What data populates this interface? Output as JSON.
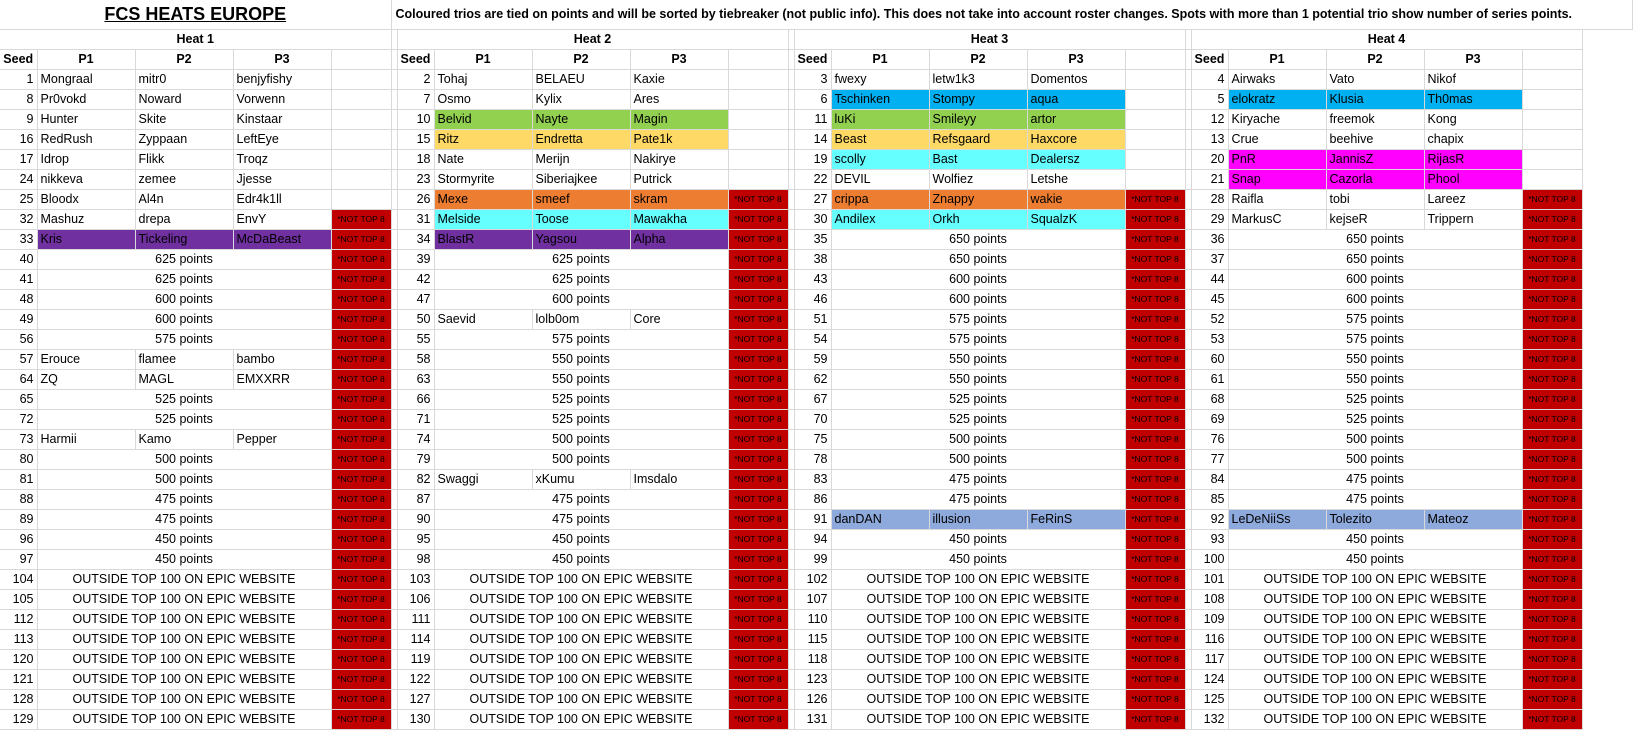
{
  "title": "FCS HEATS EUROPE",
  "note": "Coloured trios are tied on points and will be sorted by tiebreaker (not public info). This does not take into account roster changes. Spots with more than 1 potential trio show number of series points.",
  "col_headers": {
    "seed": "Seed",
    "p1": "P1",
    "p2": "P2",
    "p3": "P3"
  },
  "not_top8": "*NOT TOP 8",
  "colors": {
    "purple": "#7030a0",
    "green": "#92d050",
    "yellow": "#ffd966",
    "orange": "#ed7d31",
    "cyan": "#66ffff",
    "blue": "#00b0f0",
    "magenta": "#ff00ff",
    "periwinkle": "#8ea9db",
    "red": "#c00000"
  },
  "heats": [
    {
      "name": "Heat 1",
      "rows": [
        {
          "seed": "1",
          "p": [
            "Mongraal",
            "mitr0",
            "benjyfishy"
          ]
        },
        {
          "seed": "8",
          "p": [
            "Pr0vokd",
            "Noward",
            "Vorwenn"
          ]
        },
        {
          "seed": "9",
          "p": [
            "Hunter",
            "Skite",
            "Kinstaar"
          ]
        },
        {
          "seed": "16",
          "p": [
            "RedRush",
            "Zyppaan",
            "LeftEye"
          ]
        },
        {
          "seed": "17",
          "p": [
            "Idrop",
            "Flikk",
            "Troqz"
          ]
        },
        {
          "seed": "24",
          "p": [
            "nikkeva",
            "zemee",
            "Jjesse"
          ]
        },
        {
          "seed": "25",
          "p": [
            "Bloodx",
            "Al4n",
            "Edr4k1ll"
          ]
        },
        {
          "seed": "32",
          "p": [
            "Mashuz",
            "drepa",
            "EnvY"
          ],
          "nt": true
        },
        {
          "seed": "33",
          "p": [
            "Kris",
            "Tickeling",
            "McDaBeast"
          ],
          "color": "purple",
          "nt": true
        },
        {
          "seed": "40",
          "pts": "625 points",
          "nt": true
        },
        {
          "seed": "41",
          "pts": "625 points",
          "nt": true
        },
        {
          "seed": "48",
          "pts": "600 points",
          "nt": true
        },
        {
          "seed": "49",
          "pts": "600 points",
          "nt": true
        },
        {
          "seed": "56",
          "pts": "575 points",
          "nt": true
        },
        {
          "seed": "57",
          "p": [
            "Erouce",
            "flamee",
            "bambo"
          ],
          "nt": true
        },
        {
          "seed": "64",
          "p": [
            "ZQ",
            "MAGL",
            "EMXXRR"
          ],
          "nt": true
        },
        {
          "seed": "65",
          "pts": "525 points",
          "nt": true
        },
        {
          "seed": "72",
          "pts": "525 points",
          "nt": true
        },
        {
          "seed": "73",
          "p": [
            "Harmii",
            "Kamo",
            "Pepper"
          ],
          "nt": true
        },
        {
          "seed": "80",
          "pts": "500 points",
          "nt": true
        },
        {
          "seed": "81",
          "pts": "500 points",
          "nt": true
        },
        {
          "seed": "88",
          "pts": "475 points",
          "nt": true
        },
        {
          "seed": "89",
          "pts": "475 points",
          "nt": true
        },
        {
          "seed": "96",
          "pts": "450 points",
          "nt": true
        },
        {
          "seed": "97",
          "pts": "450 points",
          "nt": true
        },
        {
          "seed": "104",
          "pts": "OUTSIDE TOP 100 ON EPIC WEBSITE",
          "nt": true
        },
        {
          "seed": "105",
          "pts": "OUTSIDE TOP 100 ON EPIC WEBSITE",
          "nt": true
        },
        {
          "seed": "112",
          "pts": "OUTSIDE TOP 100 ON EPIC WEBSITE",
          "nt": true
        },
        {
          "seed": "113",
          "pts": "OUTSIDE TOP 100 ON EPIC WEBSITE",
          "nt": true
        },
        {
          "seed": "120",
          "pts": "OUTSIDE TOP 100 ON EPIC WEBSITE",
          "nt": true
        },
        {
          "seed": "121",
          "pts": "OUTSIDE TOP 100 ON EPIC WEBSITE",
          "nt": true
        },
        {
          "seed": "128",
          "pts": "OUTSIDE TOP 100 ON EPIC WEBSITE",
          "nt": true
        },
        {
          "seed": "129",
          "pts": "OUTSIDE TOP 100 ON EPIC WEBSITE",
          "nt": true
        }
      ]
    },
    {
      "name": "Heat 2",
      "rows": [
        {
          "seed": "2",
          "p": [
            "Tohaj",
            "BELAEU",
            "Kaxie"
          ]
        },
        {
          "seed": "7",
          "p": [
            "Osmo",
            "Kylix",
            "Ares"
          ]
        },
        {
          "seed": "10",
          "p": [
            "Belvid",
            "Nayte",
            "Magin"
          ],
          "color": "green"
        },
        {
          "seed": "15",
          "p": [
            "Ritz",
            "Endretta",
            "Pate1k"
          ],
          "color": "yellow"
        },
        {
          "seed": "18",
          "p": [
            "Nate",
            "Merijn",
            "Nakirye"
          ]
        },
        {
          "seed": "23",
          "p": [
            "Stormyrite",
            "Siberiajkee",
            "Putrick"
          ]
        },
        {
          "seed": "26",
          "p": [
            "Mexe",
            "smeef",
            "skram"
          ],
          "color": "orange",
          "nt": true
        },
        {
          "seed": "31",
          "p": [
            "Melside",
            "Toose",
            "Mawakha"
          ],
          "color": "cyan",
          "nt": true
        },
        {
          "seed": "34",
          "p": [
            "BlastR",
            "Yagsou",
            "Alpha"
          ],
          "color": "purple",
          "nt": true
        },
        {
          "seed": "39",
          "pts": "625 points",
          "nt": true
        },
        {
          "seed": "42",
          "pts": "625 points",
          "nt": true
        },
        {
          "seed": "47",
          "pts": "600 points",
          "nt": true
        },
        {
          "seed": "50",
          "p": [
            "Saevid",
            "lolb0om",
            "Core"
          ],
          "nt": true
        },
        {
          "seed": "55",
          "pts": "575 points",
          "nt": true
        },
        {
          "seed": "58",
          "pts": "550 points",
          "nt": true
        },
        {
          "seed": "63",
          "pts": "550 points",
          "nt": true
        },
        {
          "seed": "66",
          "pts": "525 points",
          "nt": true
        },
        {
          "seed": "71",
          "pts": "525 points",
          "nt": true
        },
        {
          "seed": "74",
          "pts": "500 points",
          "nt": true
        },
        {
          "seed": "79",
          "pts": "500 points",
          "nt": true
        },
        {
          "seed": "82",
          "p": [
            "Swaggi",
            "xKumu",
            "Imsdalo"
          ],
          "nt": true
        },
        {
          "seed": "87",
          "pts": "475 points",
          "nt": true
        },
        {
          "seed": "90",
          "pts": "475 points",
          "nt": true
        },
        {
          "seed": "95",
          "pts": "450 points",
          "nt": true
        },
        {
          "seed": "98",
          "pts": "450 points",
          "nt": true
        },
        {
          "seed": "103",
          "pts": "OUTSIDE TOP 100 ON EPIC WEBSITE",
          "nt": true
        },
        {
          "seed": "106",
          "pts": "OUTSIDE TOP 100 ON EPIC WEBSITE",
          "nt": true
        },
        {
          "seed": "111",
          "pts": "OUTSIDE TOP 100 ON EPIC WEBSITE",
          "nt": true
        },
        {
          "seed": "114",
          "pts": "OUTSIDE TOP 100 ON EPIC WEBSITE",
          "nt": true
        },
        {
          "seed": "119",
          "pts": "OUTSIDE TOP 100 ON EPIC WEBSITE",
          "nt": true
        },
        {
          "seed": "122",
          "pts": "OUTSIDE TOP 100 ON EPIC WEBSITE",
          "nt": true
        },
        {
          "seed": "127",
          "pts": "OUTSIDE TOP 100 ON EPIC WEBSITE",
          "nt": true
        },
        {
          "seed": "130",
          "pts": "OUTSIDE TOP 100 ON EPIC WEBSITE",
          "nt": true
        }
      ]
    },
    {
      "name": "Heat 3",
      "rows": [
        {
          "seed": "3",
          "p": [
            "fwexy",
            "letw1k3",
            "Domentos"
          ]
        },
        {
          "seed": "6",
          "p": [
            "Tschinken",
            "Stompy",
            "aqua"
          ],
          "color": "blue"
        },
        {
          "seed": "11",
          "p": [
            "luKi",
            "Smileyy",
            "artor"
          ],
          "color": "green"
        },
        {
          "seed": "14",
          "p": [
            "Beast",
            "Refsgaard",
            "Haxcore"
          ],
          "color": "yellow"
        },
        {
          "seed": "19",
          "p": [
            "scolly",
            "Bast",
            "Dealersz"
          ],
          "color": "cyan"
        },
        {
          "seed": "22",
          "p": [
            "DEVIL",
            "Wolfiez",
            "Letshe"
          ]
        },
        {
          "seed": "27",
          "p": [
            "crippa",
            "Znappy",
            "wakie"
          ],
          "color": "orange",
          "nt": true
        },
        {
          "seed": "30",
          "p": [
            "Andilex",
            "Orkh",
            "SqualzK"
          ],
          "color": "cyan",
          "nt": true
        },
        {
          "seed": "35",
          "pts": "650 points",
          "nt": true
        },
        {
          "seed": "38",
          "pts": "650 points",
          "nt": true
        },
        {
          "seed": "43",
          "pts": "600 points",
          "nt": true
        },
        {
          "seed": "46",
          "pts": "600 points",
          "nt": true
        },
        {
          "seed": "51",
          "pts": "575 points",
          "nt": true
        },
        {
          "seed": "54",
          "pts": "575 points",
          "nt": true
        },
        {
          "seed": "59",
          "pts": "550 points",
          "nt": true
        },
        {
          "seed": "62",
          "pts": "550 points",
          "nt": true
        },
        {
          "seed": "67",
          "pts": "525 points",
          "nt": true
        },
        {
          "seed": "70",
          "pts": "525 points",
          "nt": true
        },
        {
          "seed": "75",
          "pts": "500 points",
          "nt": true
        },
        {
          "seed": "78",
          "pts": "500 points",
          "nt": true
        },
        {
          "seed": "83",
          "pts": "475 points",
          "nt": true
        },
        {
          "seed": "86",
          "pts": "475 points",
          "nt": true
        },
        {
          "seed": "91",
          "p": [
            "danDAN",
            "illusion",
            "FeRinS"
          ],
          "color": "periwinkle",
          "nt": true
        },
        {
          "seed": "94",
          "pts": "450 points",
          "nt": true
        },
        {
          "seed": "99",
          "pts": "450 points",
          "nt": true
        },
        {
          "seed": "102",
          "pts": "OUTSIDE TOP 100 ON EPIC WEBSITE",
          "nt": true
        },
        {
          "seed": "107",
          "pts": "OUTSIDE TOP 100 ON EPIC WEBSITE",
          "nt": true
        },
        {
          "seed": "110",
          "pts": "OUTSIDE TOP 100 ON EPIC WEBSITE",
          "nt": true
        },
        {
          "seed": "115",
          "pts": "OUTSIDE TOP 100 ON EPIC WEBSITE",
          "nt": true
        },
        {
          "seed": "118",
          "pts": "OUTSIDE TOP 100 ON EPIC WEBSITE",
          "nt": true
        },
        {
          "seed": "123",
          "pts": "OUTSIDE TOP 100 ON EPIC WEBSITE",
          "nt": true
        },
        {
          "seed": "126",
          "pts": "OUTSIDE TOP 100 ON EPIC WEBSITE",
          "nt": true
        },
        {
          "seed": "131",
          "pts": "OUTSIDE TOP 100 ON EPIC WEBSITE",
          "nt": true
        }
      ]
    },
    {
      "name": "Heat 4",
      "rows": [
        {
          "seed": "4",
          "p": [
            "Airwaks",
            "Vato",
            "Nikof"
          ]
        },
        {
          "seed": "5",
          "p": [
            "elokratz",
            "Klusia",
            "Th0mas"
          ],
          "color": "blue"
        },
        {
          "seed": "12",
          "p": [
            "Kiryache",
            "freemok",
            "Kong"
          ]
        },
        {
          "seed": "13",
          "p": [
            "Crue",
            "beehive",
            "chapix"
          ]
        },
        {
          "seed": "20",
          "p": [
            "PnR",
            "JannisZ",
            "RijasR"
          ],
          "color": "magenta"
        },
        {
          "seed": "21",
          "p": [
            "Snap",
            "Cazorla",
            "Phool"
          ],
          "color": "magenta"
        },
        {
          "seed": "28",
          "p": [
            "Raifla",
            "tobi",
            "Lareez"
          ],
          "nt": true
        },
        {
          "seed": "29",
          "p": [
            "MarkusC",
            "kejseR",
            "Trippern"
          ],
          "nt": true
        },
        {
          "seed": "36",
          "pts": "650 points",
          "nt": true
        },
        {
          "seed": "37",
          "pts": "650 points",
          "nt": true
        },
        {
          "seed": "44",
          "pts": "600 points",
          "nt": true
        },
        {
          "seed": "45",
          "pts": "600 points",
          "nt": true
        },
        {
          "seed": "52",
          "pts": "575 points",
          "nt": true
        },
        {
          "seed": "53",
          "pts": "575 points",
          "nt": true
        },
        {
          "seed": "60",
          "pts": "550 points",
          "nt": true
        },
        {
          "seed": "61",
          "pts": "550 points",
          "nt": true
        },
        {
          "seed": "68",
          "pts": "525 points",
          "nt": true
        },
        {
          "seed": "69",
          "pts": "525 points",
          "nt": true
        },
        {
          "seed": "76",
          "pts": "500 points",
          "nt": true
        },
        {
          "seed": "77",
          "pts": "500 points",
          "nt": true
        },
        {
          "seed": "84",
          "pts": "475 points",
          "nt": true
        },
        {
          "seed": "85",
          "pts": "475 points",
          "nt": true
        },
        {
          "seed": "92",
          "p": [
            "LeDeNiiSs",
            "Tolezito",
            "Mateoz"
          ],
          "color": "periwinkle",
          "nt": true
        },
        {
          "seed": "93",
          "pts": "450 points",
          "nt": true
        },
        {
          "seed": "100",
          "pts": "450 points",
          "nt": true
        },
        {
          "seed": "101",
          "pts": "OUTSIDE TOP 100 ON EPIC WEBSITE",
          "nt": true
        },
        {
          "seed": "108",
          "pts": "OUTSIDE TOP 100 ON EPIC WEBSITE",
          "nt": true
        },
        {
          "seed": "109",
          "pts": "OUTSIDE TOP 100 ON EPIC WEBSITE",
          "nt": true
        },
        {
          "seed": "116",
          "pts": "OUTSIDE TOP 100 ON EPIC WEBSITE",
          "nt": true
        },
        {
          "seed": "117",
          "pts": "OUTSIDE TOP 100 ON EPIC WEBSITE",
          "nt": true
        },
        {
          "seed": "124",
          "pts": "OUTSIDE TOP 100 ON EPIC WEBSITE",
          "nt": true
        },
        {
          "seed": "125",
          "pts": "OUTSIDE TOP 100 ON EPIC WEBSITE",
          "nt": true
        },
        {
          "seed": "132",
          "pts": "OUTSIDE TOP 100 ON EPIC WEBSITE",
          "nt": true
        }
      ]
    }
  ]
}
